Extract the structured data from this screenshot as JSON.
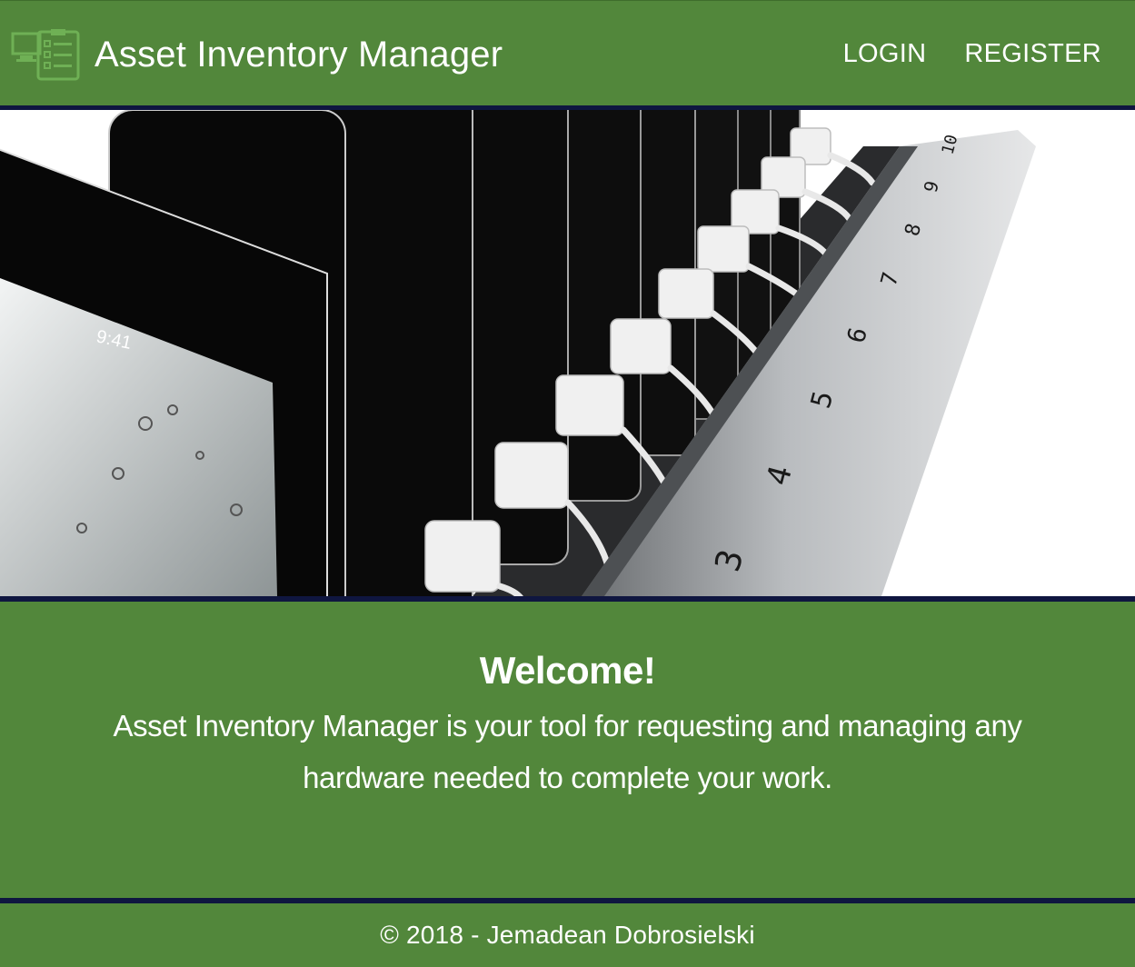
{
  "navbar": {
    "brand_icon": "inventory-checklist-icon",
    "title": "Asset Inventory Manager",
    "links": {
      "login": "LOGIN",
      "register": "REGISTER"
    }
  },
  "hero": {
    "image_label": "tablets-charging-station-photo",
    "lockscreen_time": "9:41",
    "slot_numbers": [
      "10",
      "9",
      "8",
      "7",
      "6",
      "5",
      "4",
      "3"
    ]
  },
  "welcome": {
    "heading": "Welcome!",
    "text": "Asset Inventory Manager is your tool for requesting and managing any hardware needed to complete your work."
  },
  "footer": {
    "copyright": "© 2018 - Jemadean Dobrosielski"
  },
  "colors": {
    "brand_green": "#52873b",
    "accent_navy": "#0f1640",
    "text": "#ffffff"
  }
}
